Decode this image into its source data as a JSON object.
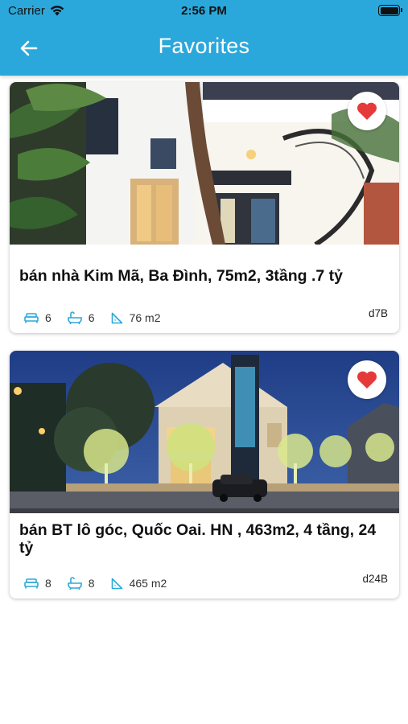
{
  "status_bar": {
    "carrier": "Carrier",
    "time": "2:56 PM"
  },
  "header": {
    "title": "Favorites",
    "back_icon": "arrow-left-icon"
  },
  "colors": {
    "header_bg": "#2ba8db",
    "favorite_heart": "#e5393a",
    "stat_icon": "#2ba8db"
  },
  "listings": [
    {
      "title": "bán nhà Kim Mã, Ba Đình, 75m2, 3tầng .7 tỷ",
      "bedrooms": "6",
      "bathrooms": "6",
      "area": "76 m2",
      "code": "d7B",
      "favorited": true
    },
    {
      "title": "bán BT lô góc, Quốc Oai. HN , 463m2, 4 tầng, 24 tỷ",
      "bedrooms": "8",
      "bathrooms": "8",
      "area": "465 m2",
      "code": "d24B",
      "favorited": true
    }
  ]
}
